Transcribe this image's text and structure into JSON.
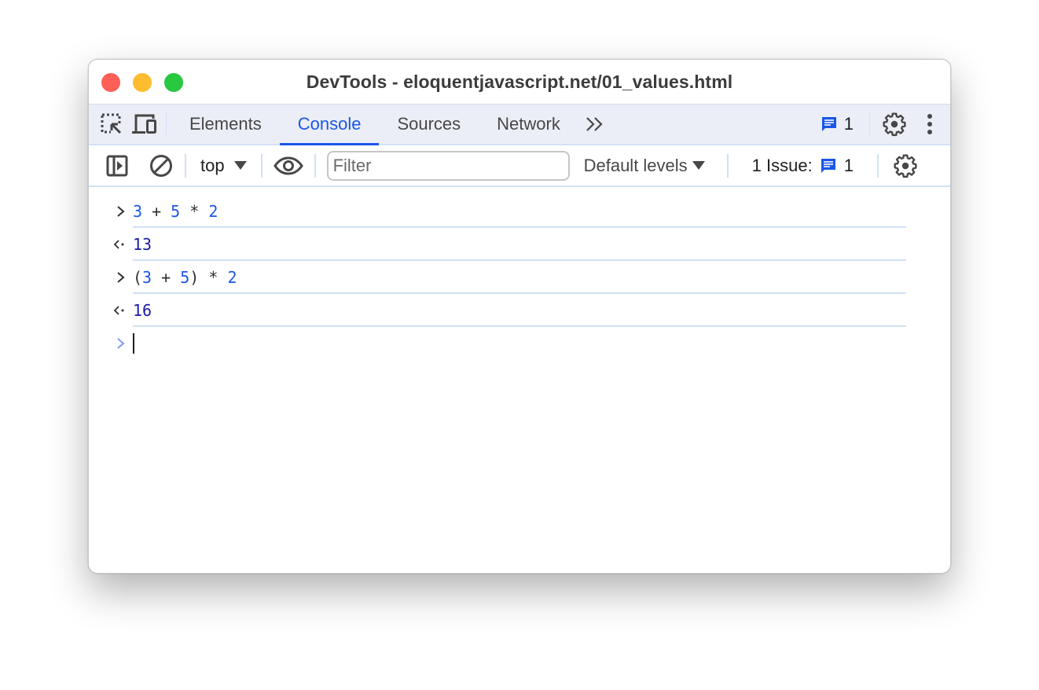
{
  "window": {
    "title": "DevTools - eloquentjavascript.net/01_values.html",
    "traffic_lights": [
      "close",
      "minimize",
      "maximize"
    ]
  },
  "tabbar": {
    "icons": [
      "inspect-element-icon",
      "device-toolbar-icon"
    ],
    "tabs": [
      {
        "label": "Elements",
        "active": false
      },
      {
        "label": "Console",
        "active": true
      },
      {
        "label": "Sources",
        "active": false
      },
      {
        "label": "Network",
        "active": false
      }
    ],
    "more_tabs_label": "»",
    "messages_count": "1",
    "right_icons": [
      "settings-icon",
      "more-vertical-icon"
    ]
  },
  "console_toolbar": {
    "context": "top",
    "filter_placeholder": "Filter",
    "filter_value": "",
    "levels_label": "Default levels",
    "issues_label": "1 Issue:",
    "issues_count": "1"
  },
  "console": {
    "entries": [
      {
        "type": "input",
        "tokens": [
          {
            "t": "3",
            "k": "num"
          },
          {
            "t": " + ",
            "k": "op"
          },
          {
            "t": "5",
            "k": "num"
          },
          {
            "t": " * ",
            "k": "op"
          },
          {
            "t": "2",
            "k": "num"
          }
        ]
      },
      {
        "type": "output",
        "value": "13"
      },
      {
        "type": "input",
        "tokens": [
          {
            "t": "(",
            "k": "op"
          },
          {
            "t": "3",
            "k": "num"
          },
          {
            "t": " + ",
            "k": "op"
          },
          {
            "t": "5",
            "k": "num"
          },
          {
            "t": ") * ",
            "k": "op"
          },
          {
            "t": "2",
            "k": "num"
          }
        ]
      },
      {
        "type": "output",
        "value": "16"
      }
    ],
    "prompt_value": ""
  },
  "colors": {
    "accent": "#1a56e8",
    "result_number": "#1a1aa6",
    "tabbar_bg": "#ebeef6",
    "divider": "#d3e1f5"
  }
}
